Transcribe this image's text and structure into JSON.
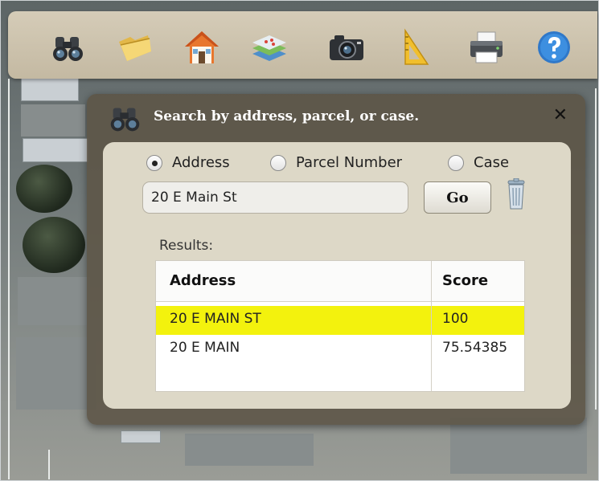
{
  "toolbar": {
    "icons": [
      "binoculars-icon",
      "folder-icon",
      "home-icon",
      "layers-icon",
      "camera-icon",
      "measure-triangle-icon",
      "printer-icon",
      "help-icon"
    ]
  },
  "search_panel": {
    "title": "Search by address, parcel, or case.",
    "close_label": "✕",
    "options": [
      {
        "label": "Address",
        "checked": true
      },
      {
        "label": "Parcel Number",
        "checked": false
      },
      {
        "label": "Case",
        "checked": false
      }
    ],
    "input_value": "20 E Main St",
    "go_label": "Go",
    "results_label": "Results:",
    "table": {
      "columns": [
        "Address",
        "Score"
      ],
      "rows": [
        {
          "address": "20 E MAIN ST",
          "score": "100",
          "selected": true
        },
        {
          "address": "20 E MAIN",
          "score": "75.54385",
          "selected": false
        }
      ]
    },
    "colors": {
      "selected_row": "#f3f20d",
      "panel": "#5c5446",
      "inner": "#ddd8c7",
      "toolbar": "#c9bea7"
    }
  }
}
